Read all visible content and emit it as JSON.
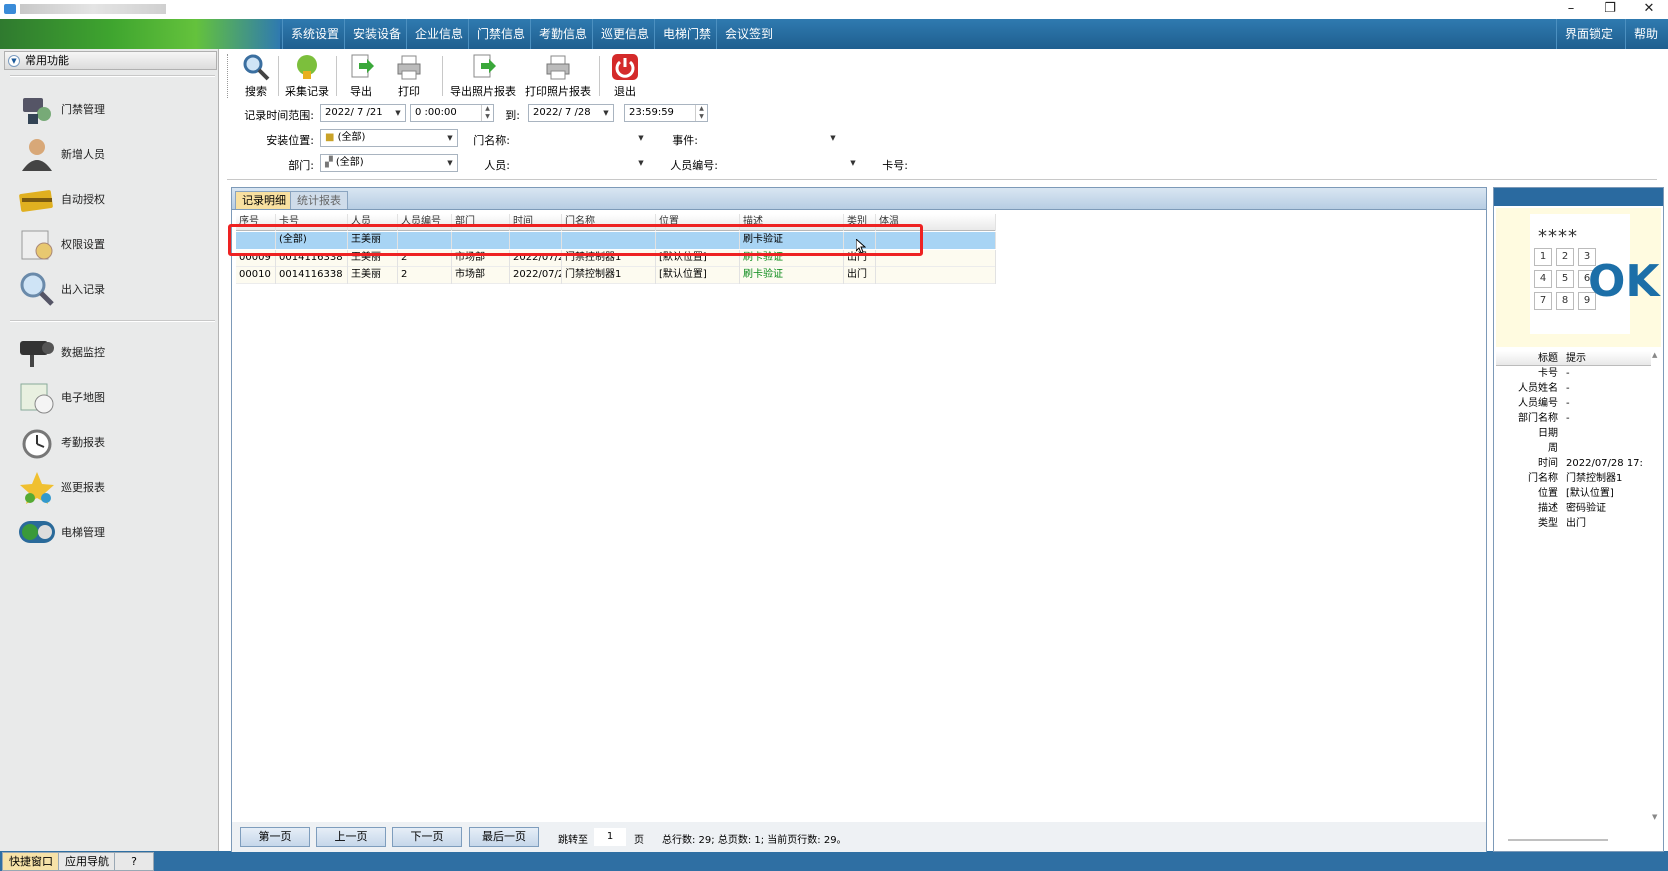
{
  "window": {
    "minimize": "–",
    "restore": "❐",
    "close": "✕"
  },
  "menu": {
    "items": [
      "系统设置",
      "安装设备",
      "企业信息",
      "门禁信息",
      "考勤信息",
      "巡更信息",
      "电梯门禁",
      "会议签到"
    ],
    "right_items": [
      "界面锁定",
      "帮助"
    ]
  },
  "sidebar": {
    "header": "常用功能",
    "items": [
      {
        "label": "门禁管理",
        "icon": "door-control-icon"
      },
      {
        "label": "新增人员",
        "icon": "person-icon"
      },
      {
        "label": "自动授权",
        "icon": "card-icon"
      },
      {
        "label": "权限设置",
        "icon": "permission-icon"
      },
      {
        "label": "出入记录",
        "icon": "magnifier-icon"
      },
      {
        "label": "数据监控",
        "icon": "camera-icon"
      },
      {
        "label": "电子地图",
        "icon": "map-icon"
      },
      {
        "label": "考勤报表",
        "icon": "clock-icon"
      },
      {
        "label": "巡更报表",
        "icon": "patrol-icon"
      },
      {
        "label": "电梯管理",
        "icon": "elevator-icon"
      }
    ]
  },
  "bottom_tabs": [
    "快捷窗口",
    "应用导航",
    "?"
  ],
  "toolbar": {
    "buttons": [
      "搜索",
      "采集记录",
      "导出",
      "打印",
      "导出照片报表",
      "打印照片报表",
      "退出"
    ]
  },
  "filters": {
    "time_range_label": "记录时间范围:",
    "start_date": "2022/ 7 /21",
    "start_time": "0 :00:00",
    "to_label": "到:",
    "end_date": "2022/ 7 /28",
    "end_time": "23:59:59",
    "location_label": "安装位置:",
    "location_value": "(全部)",
    "door_label": "门名称:",
    "door_value": "",
    "event_label": "事件:",
    "event_value": "",
    "dept_label": "部门:",
    "dept_value": "(全部)",
    "person_label": "人员:",
    "person_value": "",
    "person_no_label": "人员编号:",
    "person_no_value": "",
    "card_label": "卡号:",
    "card_value": ""
  },
  "tabs": {
    "detail": "记录明细",
    "stats": "统计报表"
  },
  "grid": {
    "columns": [
      "序号",
      "卡号",
      "人员",
      "人员编号",
      "部门",
      "时间",
      "门名称",
      "位置",
      "描述",
      "类别",
      "体温"
    ],
    "filter_row": [
      "",
      "(全部)",
      "王美丽",
      "",
      "",
      "",
      "",
      "",
      "刷卡验证",
      "",
      ""
    ],
    "rows": [
      [
        "00009",
        "0014116338",
        "王美丽",
        "2",
        "市场部",
        "2022/07/2",
        "门禁控制器1",
        "[默认位置]",
        "刷卡验证",
        "出门",
        ""
      ],
      [
        "00010",
        "0014116338",
        "王美丽",
        "2",
        "市场部",
        "2022/07/2",
        "门禁控制器1",
        "[默认位置]",
        "刷卡验证",
        "出门",
        ""
      ]
    ]
  },
  "pager": {
    "first": "第一页",
    "prev": "上一页",
    "next": "下一页",
    "last": "最后一页",
    "jump_label": "跳转至",
    "page_value": "1",
    "page_unit": "页",
    "summary": "总行数: 29; 总页数: 1; 当前页行数: 29。"
  },
  "right_panel": {
    "keypad_stars": "****",
    "keys": [
      "1",
      "2",
      "3",
      "4",
      "5",
      "6",
      "7",
      "8",
      "9"
    ],
    "ok_text": "OK",
    "header": {
      "k": "标题",
      "v": "提示"
    },
    "rows": [
      {
        "k": "卡号",
        "v": "-"
      },
      {
        "k": "人员姓名",
        "v": "-"
      },
      {
        "k": "人员编号",
        "v": "-"
      },
      {
        "k": "部门名称",
        "v": "-"
      },
      {
        "k": "日期",
        "v": ""
      },
      {
        "k": "周",
        "v": ""
      },
      {
        "k": "时间",
        "v": "2022/07/28 17:"
      },
      {
        "k": "门名称",
        "v": "门禁控制器1"
      },
      {
        "k": "位置",
        "v": "[默认位置]"
      },
      {
        "k": "描述",
        "v": "密码验证"
      },
      {
        "k": "类型",
        "v": "出门"
      }
    ]
  }
}
